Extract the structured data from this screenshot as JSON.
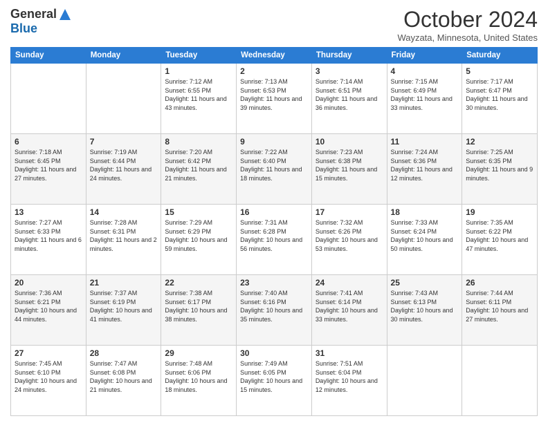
{
  "logo": {
    "general": "General",
    "blue": "Blue"
  },
  "title": "October 2024",
  "location": "Wayzata, Minnesota, United States",
  "days_of_week": [
    "Sunday",
    "Monday",
    "Tuesday",
    "Wednesday",
    "Thursday",
    "Friday",
    "Saturday"
  ],
  "weeks": [
    [
      {
        "day": "",
        "sunrise": "",
        "sunset": "",
        "daylight": ""
      },
      {
        "day": "",
        "sunrise": "",
        "sunset": "",
        "daylight": ""
      },
      {
        "day": "1",
        "sunrise": "Sunrise: 7:12 AM",
        "sunset": "Sunset: 6:55 PM",
        "daylight": "Daylight: 11 hours and 43 minutes."
      },
      {
        "day": "2",
        "sunrise": "Sunrise: 7:13 AM",
        "sunset": "Sunset: 6:53 PM",
        "daylight": "Daylight: 11 hours and 39 minutes."
      },
      {
        "day": "3",
        "sunrise": "Sunrise: 7:14 AM",
        "sunset": "Sunset: 6:51 PM",
        "daylight": "Daylight: 11 hours and 36 minutes."
      },
      {
        "day": "4",
        "sunrise": "Sunrise: 7:15 AM",
        "sunset": "Sunset: 6:49 PM",
        "daylight": "Daylight: 11 hours and 33 minutes."
      },
      {
        "day": "5",
        "sunrise": "Sunrise: 7:17 AM",
        "sunset": "Sunset: 6:47 PM",
        "daylight": "Daylight: 11 hours and 30 minutes."
      }
    ],
    [
      {
        "day": "6",
        "sunrise": "Sunrise: 7:18 AM",
        "sunset": "Sunset: 6:45 PM",
        "daylight": "Daylight: 11 hours and 27 minutes."
      },
      {
        "day": "7",
        "sunrise": "Sunrise: 7:19 AM",
        "sunset": "Sunset: 6:44 PM",
        "daylight": "Daylight: 11 hours and 24 minutes."
      },
      {
        "day": "8",
        "sunrise": "Sunrise: 7:20 AM",
        "sunset": "Sunset: 6:42 PM",
        "daylight": "Daylight: 11 hours and 21 minutes."
      },
      {
        "day": "9",
        "sunrise": "Sunrise: 7:22 AM",
        "sunset": "Sunset: 6:40 PM",
        "daylight": "Daylight: 11 hours and 18 minutes."
      },
      {
        "day": "10",
        "sunrise": "Sunrise: 7:23 AM",
        "sunset": "Sunset: 6:38 PM",
        "daylight": "Daylight: 11 hours and 15 minutes."
      },
      {
        "day": "11",
        "sunrise": "Sunrise: 7:24 AM",
        "sunset": "Sunset: 6:36 PM",
        "daylight": "Daylight: 11 hours and 12 minutes."
      },
      {
        "day": "12",
        "sunrise": "Sunrise: 7:25 AM",
        "sunset": "Sunset: 6:35 PM",
        "daylight": "Daylight: 11 hours and 9 minutes."
      }
    ],
    [
      {
        "day": "13",
        "sunrise": "Sunrise: 7:27 AM",
        "sunset": "Sunset: 6:33 PM",
        "daylight": "Daylight: 11 hours and 6 minutes."
      },
      {
        "day": "14",
        "sunrise": "Sunrise: 7:28 AM",
        "sunset": "Sunset: 6:31 PM",
        "daylight": "Daylight: 11 hours and 2 minutes."
      },
      {
        "day": "15",
        "sunrise": "Sunrise: 7:29 AM",
        "sunset": "Sunset: 6:29 PM",
        "daylight": "Daylight: 10 hours and 59 minutes."
      },
      {
        "day": "16",
        "sunrise": "Sunrise: 7:31 AM",
        "sunset": "Sunset: 6:28 PM",
        "daylight": "Daylight: 10 hours and 56 minutes."
      },
      {
        "day": "17",
        "sunrise": "Sunrise: 7:32 AM",
        "sunset": "Sunset: 6:26 PM",
        "daylight": "Daylight: 10 hours and 53 minutes."
      },
      {
        "day": "18",
        "sunrise": "Sunrise: 7:33 AM",
        "sunset": "Sunset: 6:24 PM",
        "daylight": "Daylight: 10 hours and 50 minutes."
      },
      {
        "day": "19",
        "sunrise": "Sunrise: 7:35 AM",
        "sunset": "Sunset: 6:22 PM",
        "daylight": "Daylight: 10 hours and 47 minutes."
      }
    ],
    [
      {
        "day": "20",
        "sunrise": "Sunrise: 7:36 AM",
        "sunset": "Sunset: 6:21 PM",
        "daylight": "Daylight: 10 hours and 44 minutes."
      },
      {
        "day": "21",
        "sunrise": "Sunrise: 7:37 AM",
        "sunset": "Sunset: 6:19 PM",
        "daylight": "Daylight: 10 hours and 41 minutes."
      },
      {
        "day": "22",
        "sunrise": "Sunrise: 7:38 AM",
        "sunset": "Sunset: 6:17 PM",
        "daylight": "Daylight: 10 hours and 38 minutes."
      },
      {
        "day": "23",
        "sunrise": "Sunrise: 7:40 AM",
        "sunset": "Sunset: 6:16 PM",
        "daylight": "Daylight: 10 hours and 35 minutes."
      },
      {
        "day": "24",
        "sunrise": "Sunrise: 7:41 AM",
        "sunset": "Sunset: 6:14 PM",
        "daylight": "Daylight: 10 hours and 33 minutes."
      },
      {
        "day": "25",
        "sunrise": "Sunrise: 7:43 AM",
        "sunset": "Sunset: 6:13 PM",
        "daylight": "Daylight: 10 hours and 30 minutes."
      },
      {
        "day": "26",
        "sunrise": "Sunrise: 7:44 AM",
        "sunset": "Sunset: 6:11 PM",
        "daylight": "Daylight: 10 hours and 27 minutes."
      }
    ],
    [
      {
        "day": "27",
        "sunrise": "Sunrise: 7:45 AM",
        "sunset": "Sunset: 6:10 PM",
        "daylight": "Daylight: 10 hours and 24 minutes."
      },
      {
        "day": "28",
        "sunrise": "Sunrise: 7:47 AM",
        "sunset": "Sunset: 6:08 PM",
        "daylight": "Daylight: 10 hours and 21 minutes."
      },
      {
        "day": "29",
        "sunrise": "Sunrise: 7:48 AM",
        "sunset": "Sunset: 6:06 PM",
        "daylight": "Daylight: 10 hours and 18 minutes."
      },
      {
        "day": "30",
        "sunrise": "Sunrise: 7:49 AM",
        "sunset": "Sunset: 6:05 PM",
        "daylight": "Daylight: 10 hours and 15 minutes."
      },
      {
        "day": "31",
        "sunrise": "Sunrise: 7:51 AM",
        "sunset": "Sunset: 6:04 PM",
        "daylight": "Daylight: 10 hours and 12 minutes."
      },
      {
        "day": "",
        "sunrise": "",
        "sunset": "",
        "daylight": ""
      },
      {
        "day": "",
        "sunrise": "",
        "sunset": "",
        "daylight": ""
      }
    ]
  ]
}
